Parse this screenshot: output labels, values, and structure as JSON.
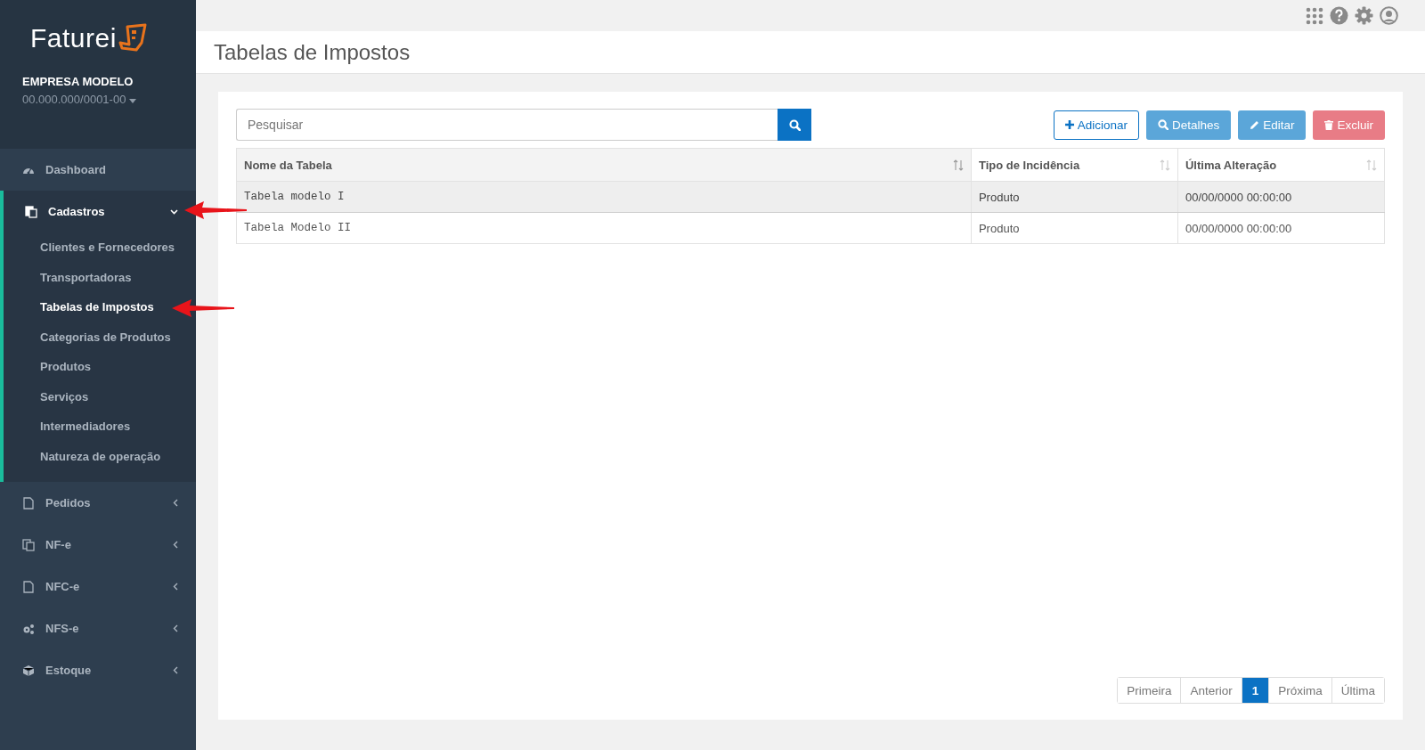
{
  "brand": {
    "logo": "Faturei",
    "company": "EMPRESA MODELO",
    "document": "00.000.000/0001-00"
  },
  "menu": [
    {
      "label": "Dashboard"
    },
    {
      "label": "Cadastros",
      "expanded": true,
      "children": [
        {
          "label": "Clientes e Fornecedores",
          "selected": false
        },
        {
          "label": "Transportadoras",
          "selected": false
        },
        {
          "label": "Tabelas de Impostos",
          "selected": true
        },
        {
          "label": "Categorias de Produtos",
          "selected": false
        },
        {
          "label": "Produtos",
          "selected": false
        },
        {
          "label": "Serviços",
          "selected": false
        },
        {
          "label": "Intermediadores",
          "selected": false
        },
        {
          "label": "Natureza de operação",
          "selected": false
        }
      ]
    },
    {
      "label": "Pedidos",
      "expanded": false
    },
    {
      "label": "NF-e",
      "expanded": false
    },
    {
      "label": "NFC-e",
      "expanded": false
    },
    {
      "label": "NFS-e",
      "expanded": false
    },
    {
      "label": "Estoque",
      "expanded": false
    }
  ],
  "page_title": "Tabelas de Impostos",
  "search": {
    "placeholder": "Pesquisar"
  },
  "actions": [
    {
      "label": "Adicionar",
      "kind": "add"
    },
    {
      "label": "Detalhes",
      "kind": "details"
    },
    {
      "label": "Editar",
      "kind": "edit"
    },
    {
      "label": "Excluir",
      "kind": "delete"
    }
  ],
  "table": {
    "columns": [
      "Nome da Tabela",
      "Tipo de Incidência",
      "Última Alteração"
    ],
    "rows": [
      {
        "cells": [
          "Tabela modelo I",
          "Produto",
          "00/00/0000 00:00:00"
        ],
        "selected": true
      },
      {
        "cells": [
          "Tabela Modelo II",
          "Produto",
          "00/00/0000 00:00:00"
        ],
        "selected": false
      }
    ]
  },
  "pagination": [
    {
      "label": "Primeira",
      "selected": false
    },
    {
      "label": "Anterior",
      "selected": false
    },
    {
      "label": "1",
      "selected": true
    },
    {
      "label": "Próxima",
      "selected": false
    },
    {
      "label": "Última",
      "selected": false
    }
  ]
}
